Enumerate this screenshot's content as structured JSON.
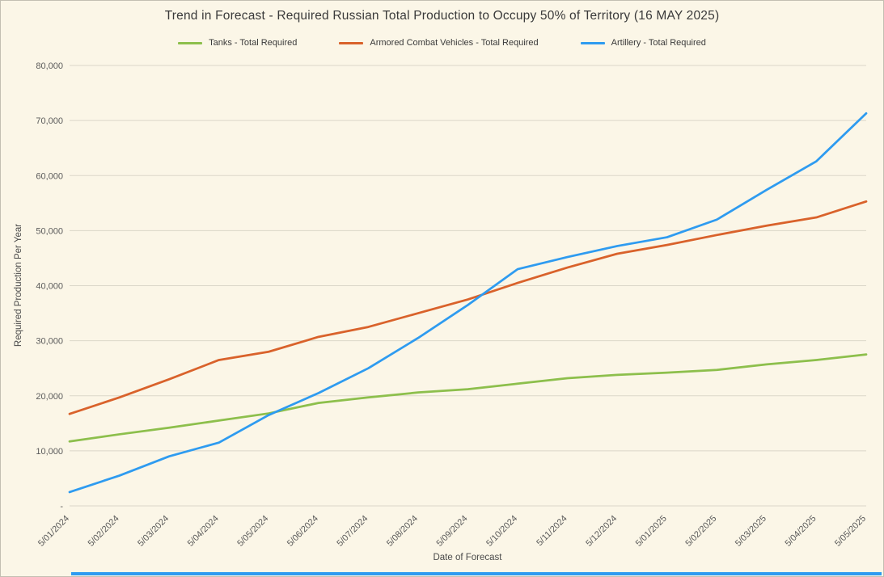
{
  "page": {
    "background_color": "#FBF6E7",
    "border_color": "#C3BFB2",
    "bottom_bar_color": "#2E9BF0"
  },
  "chart_data": {
    "type": "line",
    "title": "Trend in Forecast - Required Russian Total Production to Occupy 50% of Territory (16 MAY 2025)",
    "xlabel": "Date of Forecast",
    "ylabel": "Required Production Per Year",
    "ylim": [
      0,
      80000
    ],
    "ytick_step": 10000,
    "ytick_labels": [
      "-",
      "10,000",
      "20,000",
      "30,000",
      "40,000",
      "50,000",
      "60,000",
      "70,000",
      "80,000"
    ],
    "grid": "horizontal",
    "grid_color": "#DBD7C9",
    "legend_position": "top-center",
    "categories": [
      "5/01/2024",
      "5/02/2024",
      "5/03/2024",
      "5/04/2024",
      "5/05/2024",
      "5/06/2024",
      "5/07/2024",
      "5/08/2024",
      "5/09/2024",
      "5/10/2024",
      "5/11/2024",
      "5/12/2024",
      "5/01/2025",
      "5/02/2025",
      "5/03/2025",
      "5/04/2025",
      "5/05/2025"
    ],
    "series": [
      {
        "name": "Tanks - Total Required",
        "color": "#8DBF4C",
        "values": [
          11700,
          13000,
          14200,
          15500,
          16800,
          18700,
          19700,
          20600,
          21200,
          22200,
          23200,
          23800,
          24200,
          24700,
          25700,
          26500,
          27500
        ]
      },
      {
        "name": "Armored Combat Vehicles - Total Required",
        "color": "#D9622B",
        "values": [
          16700,
          19700,
          23000,
          26500,
          28000,
          30700,
          32500,
          35000,
          37500,
          40500,
          43300,
          45800,
          47400,
          49200,
          50900,
          52400,
          55300
        ]
      },
      {
        "name": "Artillery - Total Required",
        "color": "#2E9BF0",
        "values": [
          2500,
          5500,
          9000,
          11500,
          16500,
          20500,
          25000,
          30500,
          36500,
          43000,
          45200,
          47200,
          48800,
          52000,
          57400,
          62600,
          71300
        ]
      }
    ]
  }
}
